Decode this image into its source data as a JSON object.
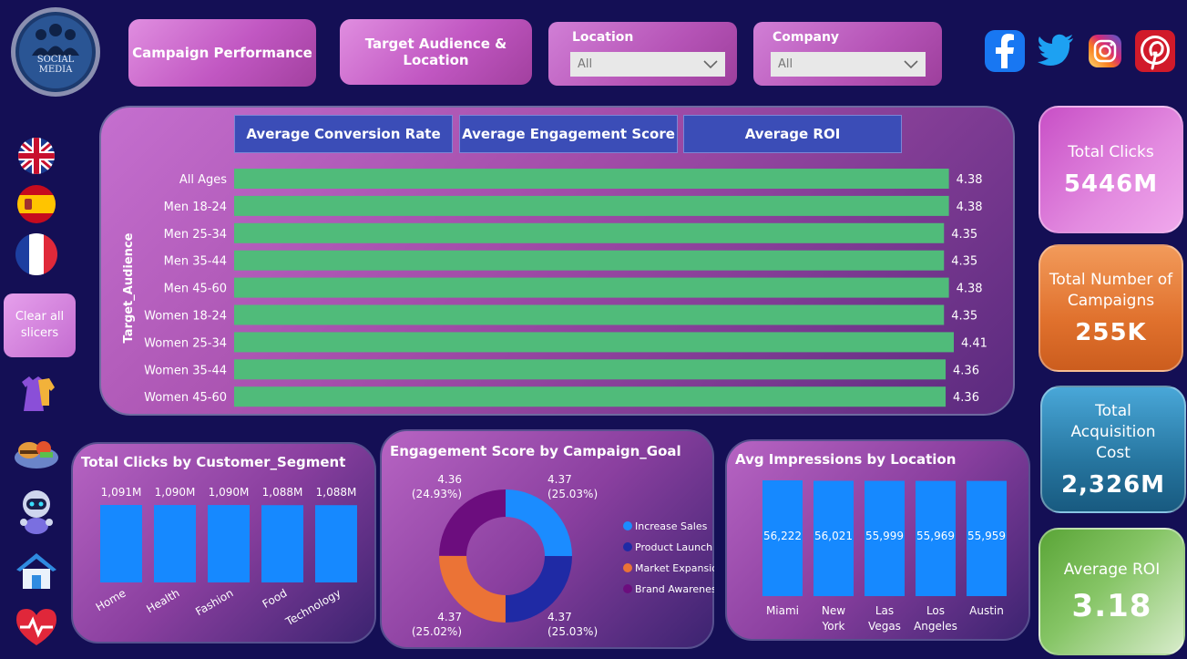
{
  "logo": {
    "text": "SOCIAL MEDIA"
  },
  "nav": {
    "campaign_performance": "Campaign Performance",
    "target_audience": "Target Audience & Location"
  },
  "slicers": {
    "location": {
      "label": "Location",
      "value": "All"
    },
    "company": {
      "label": "Company",
      "value": "All"
    }
  },
  "social_icons": [
    "facebook-icon",
    "twitter-icon",
    "instagram-icon",
    "pinterest-icon"
  ],
  "sidebar": {
    "clear_label": "Clear all slicers",
    "icons": [
      "uk-flag-icon",
      "spain-flag-icon",
      "france-flag-icon",
      "fashion-icon",
      "food-icon",
      "technology-icon",
      "home-icon",
      "health-icon"
    ]
  },
  "main_chart": {
    "buttons": [
      "Average Conversion Rate",
      "Average Engagement Score",
      "Average ROI"
    ],
    "ylabel": "Target_Audience",
    "bar_color": "#50bb7a",
    "chart_data": {
      "type": "bar",
      "categories": [
        "All Ages",
        "Men 18-24",
        "Men 25-34",
        "Men 35-44",
        "Men 45-60",
        "Women 18-24",
        "Women 25-34",
        "Women 35-44",
        "Women 45-60"
      ],
      "values": [
        4.38,
        4.38,
        4.35,
        4.35,
        4.38,
        4.35,
        4.41,
        4.36,
        4.36
      ],
      "labels": [
        "4.38",
        "4.38",
        "4.35",
        "4.35",
        "4.38",
        "4.35",
        "4.41",
        "4.36",
        "4.36"
      ]
    }
  },
  "kpis": [
    {
      "title": "Total Clicks",
      "value": "5446M"
    },
    {
      "title": "Total Number of Campaigns",
      "value": "255K"
    },
    {
      "title": "Total Acquisition Cost",
      "value": "2,326M"
    },
    {
      "title": "Average ROI",
      "value": "3.18"
    }
  ],
  "clicks_chart": {
    "title": "Total Clicks by Customer_Segment",
    "bar_color": "#1689ff",
    "chart_data": {
      "type": "bar",
      "categories": [
        "Home",
        "Health",
        "Fashion",
        "Food",
        "Technology"
      ],
      "values": [
        1091,
        1090,
        1090,
        1088,
        1088
      ],
      "labels": [
        "1,091M",
        "1,090M",
        "1,090M",
        "1,088M",
        "1,088M"
      ]
    }
  },
  "engagement_chart": {
    "title": "Engagement Score by Campaign_Goal",
    "chart_data": {
      "type": "pie",
      "categories": [
        "Increase Sales",
        "Product Launch",
        "Market Expansion",
        "Brand Awareness"
      ],
      "values": [
        4.37,
        4.37,
        4.37,
        4.36
      ],
      "percents": [
        25.03,
        25.03,
        25.02,
        24.93
      ],
      "value_labels": [
        "4.37",
        "4.37",
        "4.37",
        "4.36"
      ],
      "percent_labels": [
        "(25.03%)",
        "(25.03%)",
        "(25.02%)",
        "(24.93%)"
      ],
      "colors": [
        "#1b8cff",
        "#1f2aa5",
        "#eb7336",
        "#6c0d7e"
      ]
    }
  },
  "impressions_chart": {
    "title": "Avg Impressions by Location",
    "bar_color": "#1689ff",
    "chart_data": {
      "type": "bar",
      "categories": [
        "Miami",
        "New York",
        "Las Vegas",
        "Los Angeles",
        "Austin"
      ],
      "category_lines": [
        [
          "Miami"
        ],
        [
          "New",
          "York"
        ],
        [
          "Las",
          "Vegas"
        ],
        [
          "Los",
          "Angeles"
        ],
        [
          "Austin"
        ]
      ],
      "values": [
        56222,
        56021,
        55999,
        55969,
        55959
      ],
      "labels": [
        "56,222",
        "56,021",
        "55,999",
        "55,969",
        "55,959"
      ]
    }
  }
}
